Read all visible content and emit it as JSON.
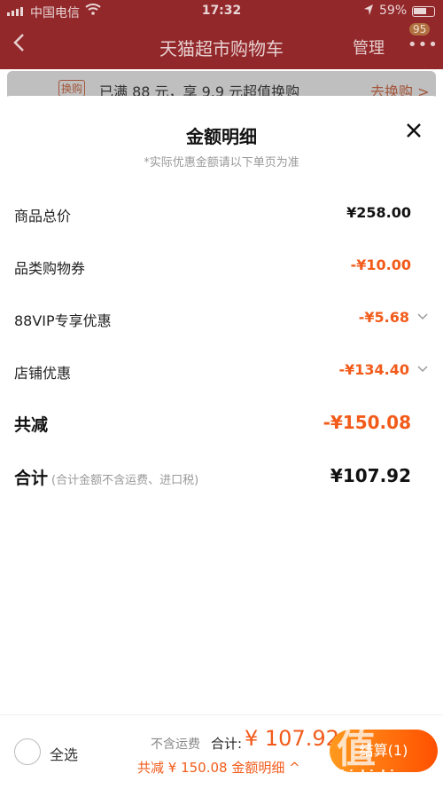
{
  "status": {
    "carrier": "中国电信",
    "time": "17:32",
    "battery": "59%"
  },
  "nav": {
    "back_icon": "chevron-left-icon",
    "title": "天猫超市购物车",
    "manage": "管理",
    "badge": "95"
  },
  "promo": {
    "tag": "换购",
    "text": "已满 88 元，享 9.9 元超值换购",
    "link": "去换购 >"
  },
  "sheet": {
    "title": "金额明细",
    "subtitle": "*实际优惠金额请以下单页为准",
    "rows": [
      {
        "label": "商品总价",
        "value": "¥258.00"
      },
      {
        "label": "品类购物券",
        "value": "-¥10.00"
      },
      {
        "label": "88VIP专享优惠",
        "value": "-¥5.68"
      },
      {
        "label": "店铺优惠",
        "value": "-¥134.40"
      },
      {
        "label": "共减",
        "value": "-¥150.08"
      },
      {
        "label": "合计",
        "note": "(合计金额不含运费、进口税)",
        "value": "¥107.92"
      }
    ]
  },
  "bottom": {
    "select_all": "全选",
    "shipping_note": "不含运费",
    "total_label": "合计:",
    "total_value": "¥ 107.92",
    "reduce_text": "共减 ¥ 150.08",
    "detail_link": "金额明细 ^",
    "checkout": "结算(1)"
  },
  "watermark": {
    "logo": "值",
    "site": "zhizhizhi.com"
  },
  "colors": {
    "nav_bg": "#93282b",
    "accent_orange": "#f25b1a",
    "checkout_start": "#ff9a1e",
    "checkout_end": "#ff5000"
  }
}
